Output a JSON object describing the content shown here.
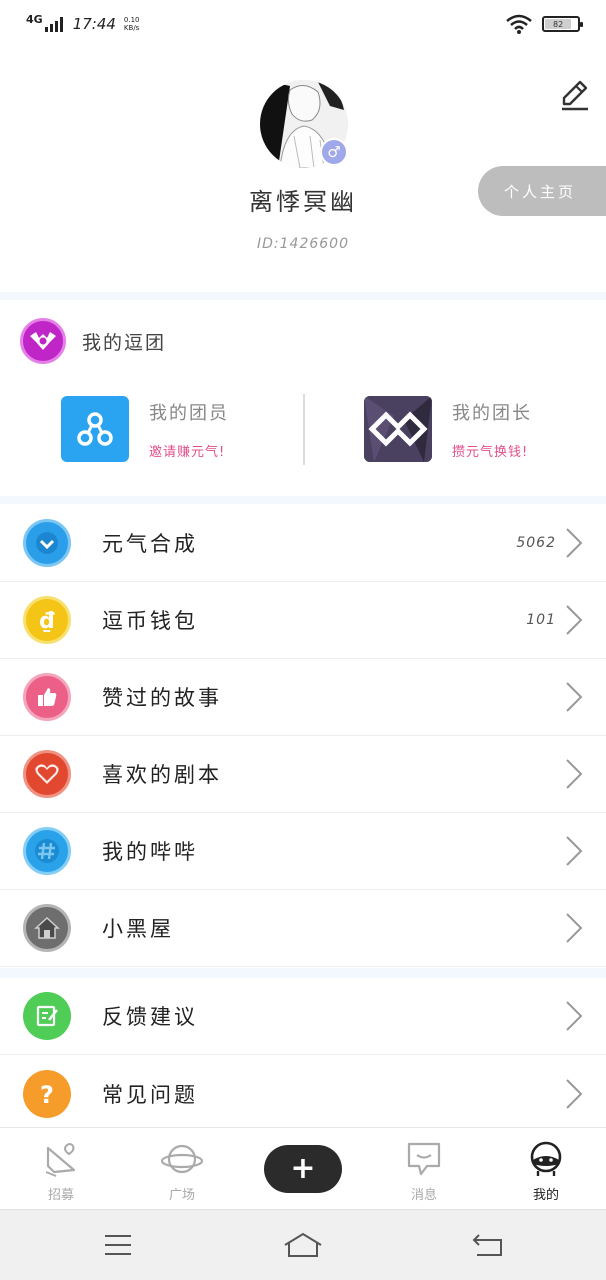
{
  "status_bar": {
    "network": "4G",
    "time": "17:44",
    "speed_value": "0.10",
    "speed_unit": "KB/s",
    "battery": "82"
  },
  "profile": {
    "username": "离悸冥幽",
    "user_id": "ID:1426600",
    "gender_symbol": "♂",
    "homepage_label": "个人主页"
  },
  "team": {
    "title": "我的逗团",
    "members": {
      "title": "我的团员",
      "subtitle": "邀请赚元气!"
    },
    "leader": {
      "title": "我的团长",
      "subtitle": "攒元气换钱!"
    }
  },
  "menu": [
    {
      "label": "元气合成",
      "value": "5062",
      "icon": "heart-shield-icon",
      "color": "#2a9ee8"
    },
    {
      "label": "逗币钱包",
      "value": "101",
      "icon": "coin-icon",
      "color": "#f4c517"
    },
    {
      "label": "赞过的故事",
      "value": "",
      "icon": "thumbs-up-icon",
      "color": "#ec5f86"
    },
    {
      "label": "喜欢的剧本",
      "value": "",
      "icon": "heart-icon",
      "color": "#e2472f"
    },
    {
      "label": "我的哔哔",
      "value": "",
      "icon": "hashtag-icon",
      "color": "#2aa2ea"
    },
    {
      "label": "小黑屋",
      "value": "",
      "icon": "house-icon",
      "color": "#6e6e6e"
    },
    {
      "label": "反馈建议",
      "value": "",
      "icon": "feedback-icon",
      "color": "#4fcd57"
    },
    {
      "label": "常见问题",
      "value": "",
      "icon": "question-icon",
      "color": "#f59c2b"
    }
  ],
  "tabs": [
    {
      "label": "招募",
      "icon": "recruit-icon"
    },
    {
      "label": "广场",
      "icon": "planet-icon"
    },
    {
      "label": "消息",
      "icon": "message-icon"
    },
    {
      "label": "我的",
      "icon": "profile-icon",
      "active": true
    }
  ],
  "create_label": "+"
}
